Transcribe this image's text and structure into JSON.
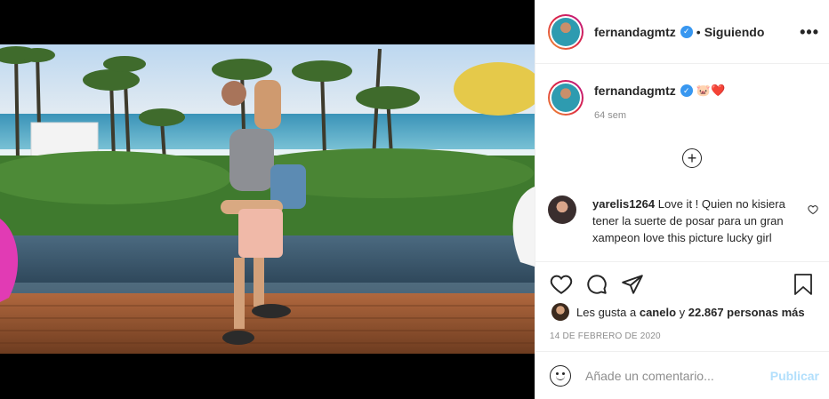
{
  "header": {
    "username": "fernandagmtz",
    "separator": "•",
    "following_label": "Siguiendo",
    "more_label": "•••"
  },
  "caption": {
    "username": "fernandagmtz",
    "emojis": "🐷❤️",
    "timestamp": "64 sem"
  },
  "comments": [
    {
      "username": "yarelis1264",
      "text": "Love it ! Quien no kisiera tener la suerte de posar para un gran xampeon love this picture lucky girl"
    }
  ],
  "likes": {
    "prefix": "Les gusta a",
    "user": "canelo",
    "connector": "y",
    "count": "22.867 personas más"
  },
  "date": "14 DE FEBRERO DE 2020",
  "add_comment": {
    "placeholder": "Añade un comentario...",
    "publish_label": "Publicar"
  },
  "icons": {
    "verified": "verified-badge-icon",
    "more": "more-options-icon",
    "add": "plus-circle-icon",
    "like": "heart-icon",
    "comment": "comment-icon",
    "share": "paper-plane-icon",
    "save": "bookmark-icon",
    "emoji": "smiley-icon"
  },
  "colors": {
    "verified": "#3897f0",
    "publish_disabled": "#b2dffc",
    "meta_gray": "#8e8e8e"
  }
}
